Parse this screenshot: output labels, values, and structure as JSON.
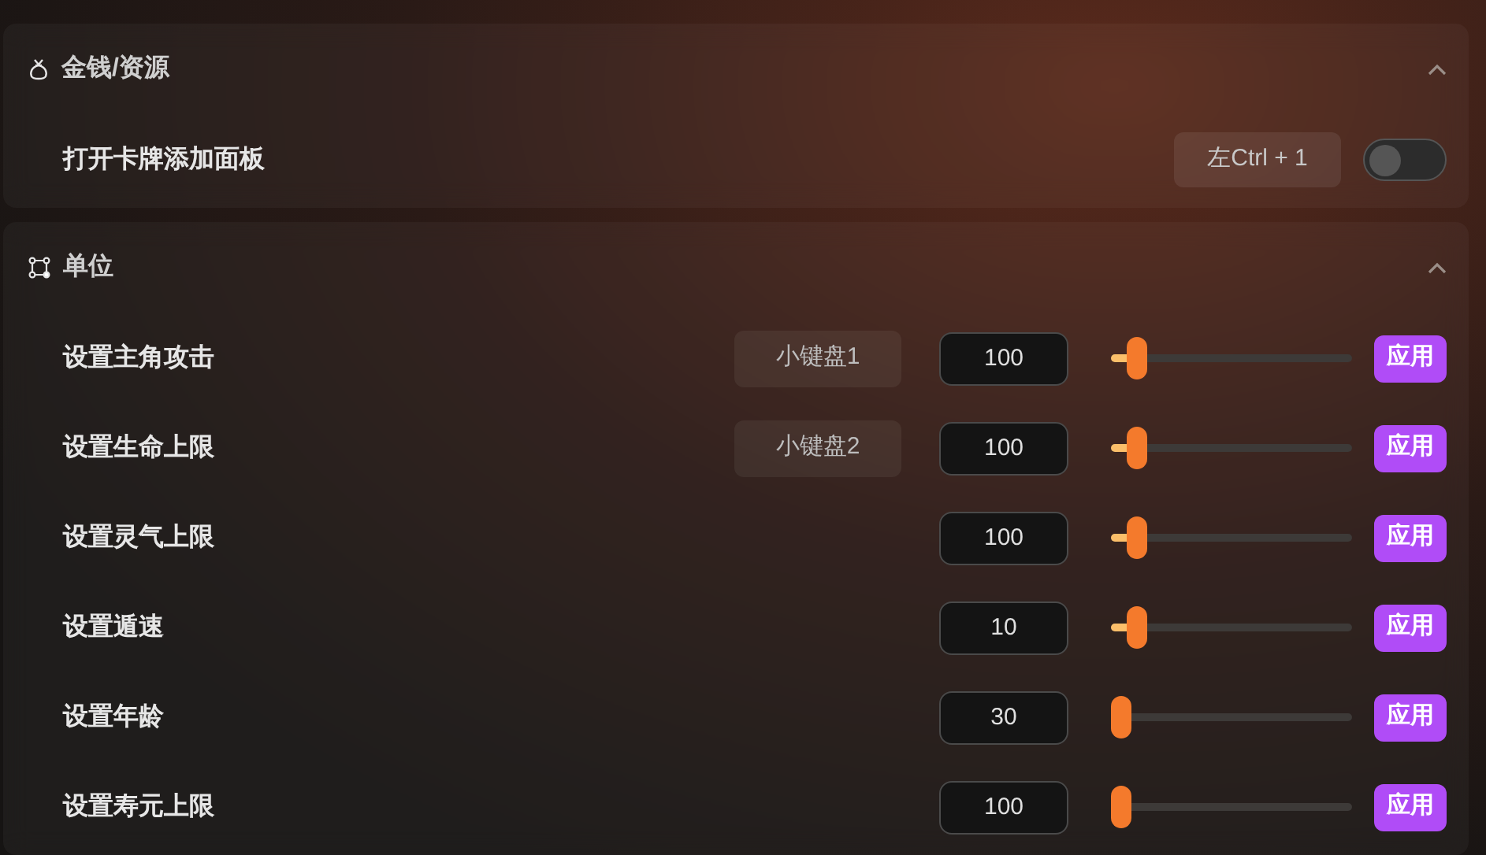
{
  "sections": [
    {
      "kind": "money",
      "title": "金钱/资源",
      "expanded": true,
      "rows": [
        {
          "kind": "toggle",
          "label": "打开卡牌添加面板",
          "hotkey": "左Ctrl + 1",
          "on": false
        }
      ]
    },
    {
      "kind": "unit",
      "title": "单位",
      "expanded": true,
      "rows": [
        {
          "kind": "slider",
          "label": "设置主角攻击",
          "hotkey": "小键盘1",
          "value": "100",
          "level": 0.07,
          "button": "应用"
        },
        {
          "kind": "slider",
          "label": "设置生命上限",
          "hotkey": "小键盘2",
          "value": "100",
          "level": 0.07,
          "button": "应用"
        },
        {
          "kind": "slider",
          "label": "设置灵气上限",
          "value": "100",
          "level": 0.07,
          "button": "应用"
        },
        {
          "kind": "slider",
          "label": "设置遁速",
          "value": "10",
          "level": 0.07,
          "button": "应用"
        },
        {
          "kind": "slider",
          "label": "设置年龄",
          "value": "30",
          "level": 0,
          "button": "应用"
        },
        {
          "kind": "slider",
          "label": "设置寿元上限",
          "value": "100",
          "level": 0,
          "button": "应用"
        }
      ]
    }
  ]
}
